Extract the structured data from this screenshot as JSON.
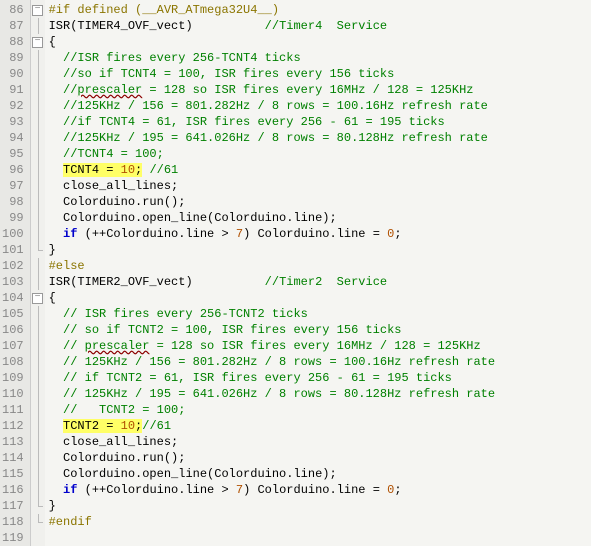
{
  "lineStart": 86,
  "lines": [
    "<span class='pp'>#if defined (__AVR_ATmega32U4__)</span>",
    "<span class='id'>ISR</span><span class='paren'>(</span><span class='id'>TIMER4_OVF_vect</span><span class='paren'>)</span>          <span class='cm'>//Timer4  Service</span>",
    "<span class='op'>{</span>",
    "  <span class='cm'>//ISR fires every 256-TCNT4 ticks</span>",
    "  <span class='cm'>//so if TCNT4 = 100, ISR fires every 156 ticks</span>",
    "  <span class='cm'>//<span class='u'>prescaler</span> = 128 so ISR fires every 16MHz / 128 = 125KHz</span>",
    "  <span class='cm'>//125KHz / 156 = 801.282Hz / 8 rows = 100.16Hz refresh rate</span>",
    "  <span class='cm'>//if TCNT4 = 61, ISR fires every 256 - 61 = 195 ticks</span>",
    "  <span class='cm'>//125KHz / 195 = 641.026Hz / 8 rows = 80.128Hz refresh rate</span>",
    "  <span class='cm'>//TCNT4 = 100;</span>",
    "  <span class='hl'><span class='id'>TCNT4</span> <span class='op'>=</span> <span class='num'>10</span><span class='op'>;</span></span> <span class='cm'>//61</span>",
    "  <span class='id'>close_all_lines</span><span class='op'>;</span>",
    "  <span class='id'>Colorduino</span><span class='op'>.</span><span class='id'>run</span><span class='paren'>()</span><span class='op'>;</span>",
    "  <span class='id'>Colorduino</span><span class='op'>.</span><span class='id'>open_line</span><span class='paren'>(</span><span class='id'>Colorduino</span><span class='op'>.</span><span class='id'>line</span><span class='paren'>)</span><span class='op'>;</span>",
    "  <span class='kw'>if</span> <span class='paren'>(</span><span class='op'>++</span><span class='id'>Colorduino</span><span class='op'>.</span><span class='id'>line</span> <span class='op'>&gt;</span> <span class='num'>7</span><span class='paren'>)</span> <span class='id'>Colorduino</span><span class='op'>.</span><span class='id'>line</span> <span class='op'>=</span> <span class='num'>0</span><span class='op'>;</span>",
    "<span class='op'>}</span>",
    "<span class='pp'>#else</span>",
    "<span class='id'>ISR</span><span class='paren'>(</span><span class='id'>TIMER2_OVF_vect</span><span class='paren'>)</span>          <span class='cm'>//Timer2  Service</span>",
    "<span class='op'>{</span>",
    "  <span class='cm'>// ISR fires every 256-TCNT2 ticks</span>",
    "  <span class='cm'>// so if TCNT2 = 100, ISR fires every 156 ticks</span>",
    "  <span class='cm'>// <span class='u'>prescaler</span> = 128 so ISR fires every 16MHz / 128 = 125KHz</span>",
    "  <span class='cm'>// 125KHz / 156 = 801.282Hz / 8 rows = 100.16Hz refresh rate</span>",
    "  <span class='cm'>// if TCNT2 = 61, ISR fires every 256 - 61 = 195 ticks</span>",
    "  <span class='cm'>// 125KHz / 195 = 641.026Hz / 8 rows = 80.128Hz refresh rate</span>",
    "  <span class='cm'>//   TCNT2 = 100;</span>",
    "  <span class='hl'><span class='id'>TCNT2</span> <span class='op'>=</span> <span class='num'>10</span><span class='op'>;</span></span><span class='cm'>//61</span>",
    "  <span class='id'>close_all_lines</span><span class='op'>;</span>",
    "  <span class='id'>Colorduino</span><span class='op'>.</span><span class='id'>run</span><span class='paren'>()</span><span class='op'>;</span>",
    "  <span class='id'>Colorduino</span><span class='op'>.</span><span class='id'>open_line</span><span class='paren'>(</span><span class='id'>Colorduino</span><span class='op'>.</span><span class='id'>line</span><span class='paren'>)</span><span class='op'>;</span>",
    "  <span class='kw'>if</span> <span class='paren'>(</span><span class='op'>++</span><span class='id'>Colorduino</span><span class='op'>.</span><span class='id'>line</span> <span class='op'>&gt;</span> <span class='num'>7</span><span class='paren'>)</span> <span class='id'>Colorduino</span><span class='op'>.</span><span class='id'>line</span> <span class='op'>=</span> <span class='num'>0</span><span class='op'>;</span>",
    "<span class='op'>}</span>",
    "<span class='pp'>#endif</span>",
    ""
  ],
  "foldMarks": [
    "box",
    "line",
    "box",
    "line",
    "line",
    "line",
    "line",
    "line",
    "line",
    "line",
    "line",
    "line",
    "line",
    "line",
    "line",
    "end",
    "line",
    "line",
    "box",
    "line",
    "line",
    "line",
    "line",
    "line",
    "line",
    "line",
    "line",
    "line",
    "line",
    "line",
    "line",
    "end",
    "end",
    ""
  ]
}
